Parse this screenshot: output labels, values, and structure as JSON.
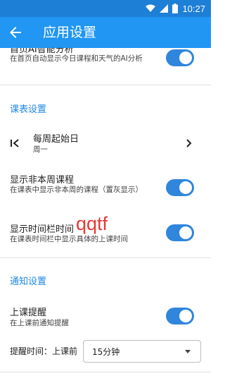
{
  "status_bar": {
    "time": "10:27"
  },
  "app_bar": {
    "title": "应用设置"
  },
  "ai_row": {
    "title": "首页AI智能分析",
    "subtitle": "在首页自动显示今日课程和天气的AI分析",
    "enabled": true
  },
  "schedule_section": {
    "header": "课表设置",
    "week_start": {
      "title": "每周起始日",
      "value": "周一"
    },
    "show_non_week": {
      "title": "显示非本周课程",
      "subtitle": "在课表中显示非本周的课程（置灰显示）",
      "enabled": true
    },
    "show_time_column": {
      "title": "显示时间栏时间",
      "subtitle": "在课表时间栏中显示具体的上课时间",
      "enabled": true
    }
  },
  "notify_section": {
    "header": "通知设置",
    "class_reminder": {
      "title": "上课提醒",
      "subtitle": "在上课前通知提醒",
      "enabled": true
    },
    "reminder_time": {
      "label": "提醒时间：上课前",
      "value": "15分钟"
    }
  },
  "watermark": "qqtf",
  "colors": {
    "primary": "#2196f3",
    "status_bar": "#1e7fd6",
    "accent": "#1e88e5",
    "switch_on": "#2f86dc"
  }
}
